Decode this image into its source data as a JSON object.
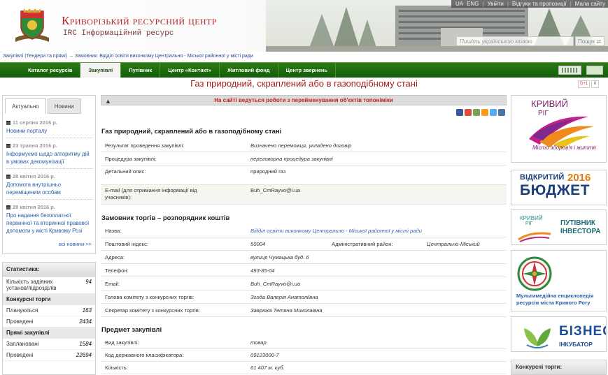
{
  "header": {
    "title": "Криворізький ресурсний центр",
    "subtitle": "IRC Інформаційний ресурс",
    "topbar": [
      "UA",
      "ENG",
      "Увійти",
      "Відгуки та пропозиції",
      "Мала сайту"
    ],
    "search_placeholder": "Пишіть українською мовою",
    "search_button": "Пошук"
  },
  "breadcrumb": {
    "part1": "Закупівлі (Тендери та прямі)",
    "arrow": "→",
    "part2": "Замовник: Відділ освіти виконкому Центрально - Міської районної у місті ради"
  },
  "nav": {
    "items": [
      "Каталог ресурсів",
      "Закупівлі",
      "Путівник",
      "Центр «Контакт»",
      "Житловий фонд",
      "Центр звернень"
    ],
    "active_index": 1
  },
  "page_title": "Газ природний, скраплений або в газоподібному стані",
  "share": {
    "gplus": "G+1",
    "count": "0"
  },
  "news": {
    "tabs": [
      "Актуально",
      "Новини"
    ],
    "items": [
      {
        "date": "11 серпня 2016 р.",
        "text": "Новини порталу"
      },
      {
        "date": "23 травня 2016 р.",
        "text": "Інформуємо щодо алгоритму дій в умовах декомунізації"
      },
      {
        "date": "28 квітня 2016 р.",
        "text": "Допомога внутрішньо переміщеним особам"
      },
      {
        "date": "28 квітня 2016 р.",
        "text": "Про надання безоплатної первинної та вторинної правової допомоги у місті Кривому Розі"
      }
    ],
    "all_link": "всі новини >>"
  },
  "stats": {
    "title": "Статистика:",
    "institutions_label": "Кількість задіяних установ/підрозділів",
    "institutions_value": "94",
    "competitive_title": "Конкурсні торги",
    "planned_label": "Плануються",
    "planned_value": "163",
    "held_label": "Проведені",
    "held_value": "2434",
    "direct_title": "Прямі закупівлі",
    "direct_planned_label": "Заплановані",
    "direct_planned_value": "1584",
    "direct_held_label": "Проведені",
    "direct_held_value": "22694"
  },
  "notice": "На сайті ведуться роботи з перейменування об'єктів топоніміки",
  "purchase": {
    "title": "Газ природний, скраплений або в газоподібному стані",
    "result_label": "Результат проведення закупівлі:",
    "result_value": "Визначено переможця, укладено договір",
    "procedure_label": "Процедура закупівлі:",
    "procedure_value": "переговорна процедура закупівлі",
    "details_label": "Детальний опис:",
    "details_value": "природний газ",
    "email_label": "E-mail (для отримання інформації від учасників):",
    "email_value": "Buh_CmRayvo@i.ua"
  },
  "customer": {
    "title": "Замовник торгів – розпорядник коштів",
    "name_label": "Назва:",
    "name_value": "Відділ освіти виконкому Центрально - Міської районної у місті ради",
    "zip_label": "Поштовий індекс:",
    "zip_value": "50004",
    "district_label": "Адміністративний район:",
    "district_value": "Центрально-Міський",
    "address_label": "Адреса:",
    "address_value": "вулиця Чумацька буд. 6",
    "phone_label": "Телефон:",
    "phone_value": "493-85-04",
    "email_label": "Email:",
    "email_value": "Buh_CmRayvo@i.ua",
    "head_label": "Голова комітету з конкурсних торгів:",
    "head_value": "Згода Валерія Анатоліївна",
    "secretary_label": "Секретар комітету з конкурсних торгів:",
    "secretary_value": "Заврюха Тетяна Миколаївна"
  },
  "subject": {
    "title": "Предмет закупівлі",
    "kind_label": "Вид закупівлі:",
    "kind_value": "товар",
    "code_label": "Код державного класифікатора:",
    "code_value": "09123000-7",
    "qty_label": "Кількість:",
    "qty_value": "61 407  м. куб."
  },
  "banners": {
    "kr_title1": "КРИВИЙ",
    "kr_title2": "РІГ",
    "kr_motto": "Місто здоров'я і життя",
    "budget1": "ВІДКРИТИЙ",
    "budget_year": "2016",
    "budget2": "БЮДЖЕТ",
    "inv_l1": "КРИВИЙ",
    "inv_l2": "РІГ",
    "inv_r1": "ПУТІВНИК",
    "inv_r2": "ІНВЕСТОРА",
    "encyclopedia": "Мультимедійна енциклопедія ресурсів міста Кривого Рогу",
    "biz1": "БІЗНЕС",
    "biz2": "ІНКУБАТОР"
  },
  "right_competitive": "Конкурсні торги:",
  "colors": {
    "nav_green": "#1e6b10",
    "title_red": "#a51d1d",
    "link_blue": "#2a5ea8"
  }
}
